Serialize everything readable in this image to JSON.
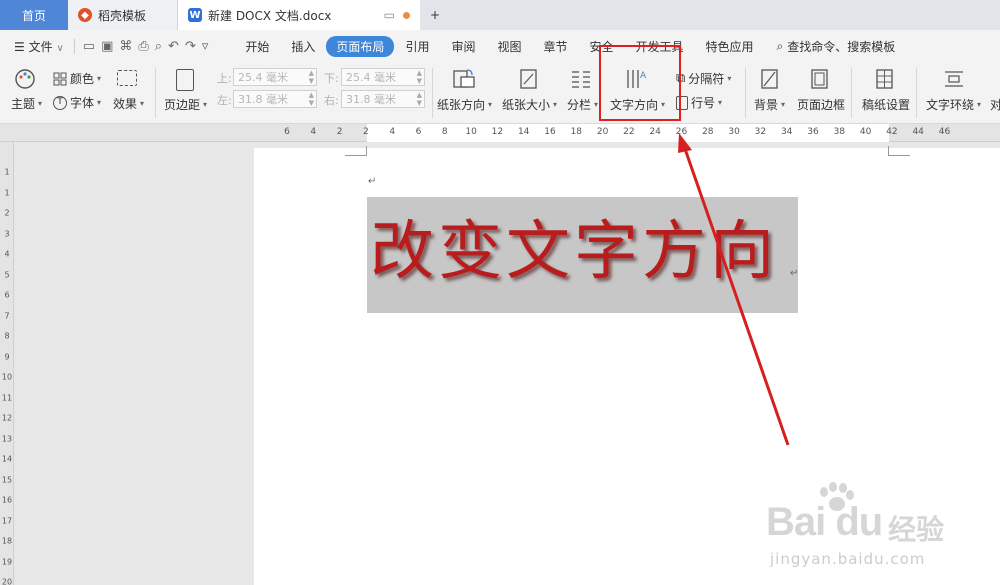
{
  "tabs": {
    "home": "首页",
    "templates": "稻壳模板",
    "doc_title": "新建 DOCX 文档.docx",
    "add": "+"
  },
  "menubar": {
    "file": "文件",
    "file_arrow": "∨",
    "tabs": [
      "开始",
      "插入",
      "页面布局",
      "引用",
      "审阅",
      "视图",
      "章节",
      "安全",
      "开发工具",
      "特色应用"
    ],
    "active_tab": "页面布局",
    "search": "查找命令、搜索模板"
  },
  "ribbon": {
    "theme": "主题",
    "color": "颜色",
    "font": "字体",
    "effect": "效果",
    "margins": "页边距",
    "top_label": "上:",
    "top_value": "25.4 毫米",
    "bottom_label": "下:",
    "bottom_value": "25.4 毫米",
    "left_label": "左:",
    "left_value": "31.8 毫米",
    "right_label": "右:",
    "right_value": "31.8 毫米",
    "orientation": "纸张方向",
    "size": "纸张大小",
    "columns": "分栏",
    "text_direction": "文字方向",
    "separator": "分隔符",
    "line_numbers": "行号",
    "background": "背景",
    "page_border": "页面边框",
    "manuscript": "稿纸设置",
    "text_wrap": "文字环绕",
    "align": "对"
  },
  "ruler": {
    "h_labels": [
      "6",
      "4",
      "2",
      "2",
      "4",
      "6",
      "8",
      "10",
      "12",
      "14",
      "16",
      "18",
      "20",
      "22",
      "24",
      "26",
      "28",
      "30",
      "32",
      "34",
      "36",
      "38",
      "40",
      "42",
      "44",
      "46"
    ],
    "v_labels": [
      "1",
      "1",
      "2",
      "3",
      "4",
      "5",
      "6",
      "7",
      "8",
      "9",
      "10",
      "11",
      "12",
      "13",
      "14",
      "15",
      "16",
      "17",
      "18",
      "19",
      "20"
    ]
  },
  "document": {
    "heading_text": "改变文字方向",
    "para_mark": "↵",
    "heading_color": "#b81c1c"
  },
  "watermark": {
    "logo": "Bai du",
    "cn": "经验",
    "url": "jingyan.baidu.com"
  },
  "colors": {
    "accent": "#3d86d9",
    "highlight_box": "#e02020",
    "home_tab": "#4f86d6"
  }
}
